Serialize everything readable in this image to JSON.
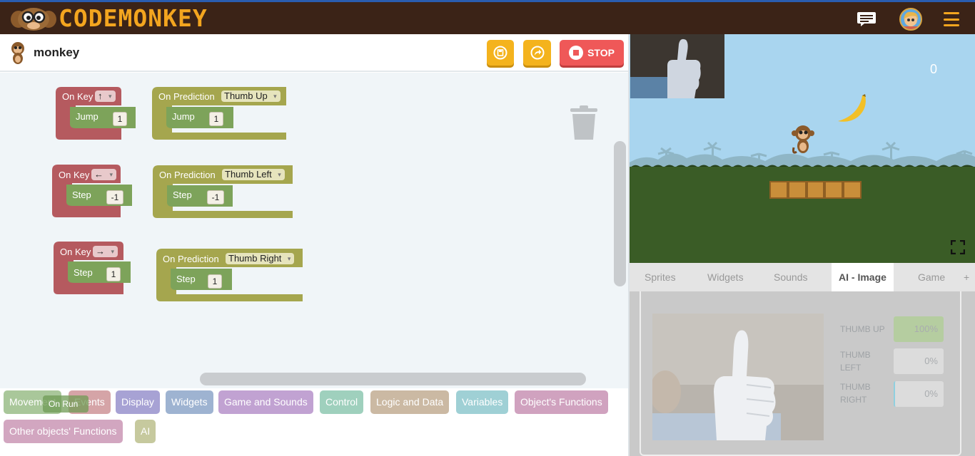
{
  "brand": {
    "logo_text_code": "CODE",
    "logo_text_monkey": "MONKEY",
    "accent": "#f3a51f",
    "topbar_color": "#3b2317"
  },
  "header": {
    "project_name": "monkey",
    "stop_label": "STOP"
  },
  "blocks": [
    {
      "event": "On Key",
      "key": "↑",
      "action": "Jump",
      "value": "1",
      "color": "#b55a5f"
    },
    {
      "event": "On Prediction",
      "key": "Thumb Up",
      "action": "Jump",
      "value": "1",
      "color": "#a5a64e"
    },
    {
      "event": "On Key",
      "key": "←",
      "action": "Step",
      "value": "-1",
      "color": "#b55a5f"
    },
    {
      "event": "On Prediction",
      "key": "Thumb Left",
      "action": "Step",
      "value": "-1",
      "color": "#a5a64e"
    },
    {
      "event": "On Key",
      "key": "→",
      "action": "Step",
      "value": "1",
      "color": "#b55a5f"
    },
    {
      "event": "On Prediction",
      "key": "Thumb Right",
      "action": "Step",
      "value": "1",
      "color": "#a5a64e"
    }
  ],
  "drag_ghost": {
    "label": "On Run"
  },
  "categories": [
    {
      "label": "Movement",
      "color": "#a9c79a"
    },
    {
      "label": "Events",
      "color": "#d5a4a7"
    },
    {
      "label": "Display",
      "color": "#a7a2d4"
    },
    {
      "label": "Widgets",
      "color": "#9eb3d1"
    },
    {
      "label": "Game and Sounds",
      "color": "#c1a2d2"
    },
    {
      "label": "Control",
      "color": "#9fd0bd"
    },
    {
      "label": "Logic and Data",
      "color": "#cbb9a3"
    },
    {
      "label": "Variables",
      "color": "#9fd0d5"
    },
    {
      "label": "Object's Functions",
      "color": "#d0a2bf"
    },
    {
      "label": "Other objects' Functions",
      "color": "#d2a6c0"
    },
    {
      "label": "AI",
      "color": "#c6c99e"
    }
  ],
  "game": {
    "score": "0"
  },
  "tabs": [
    {
      "label": "Sprites"
    },
    {
      "label": "Widgets"
    },
    {
      "label": "Sounds"
    },
    {
      "label": "AI - Image",
      "active": true
    },
    {
      "label": "Game"
    },
    {
      "label": "+"
    }
  ],
  "predictions": [
    {
      "label_line1": "THUMB UP",
      "label_line2": "",
      "value": "100%",
      "fraction": 1.0
    },
    {
      "label_line1": "THUMB",
      "label_line2": "LEFT",
      "value": "0%",
      "fraction": 0.0
    },
    {
      "label_line1": "THUMB",
      "label_line2": "RIGHT",
      "value": "0%",
      "fraction": 0.0
    }
  ]
}
